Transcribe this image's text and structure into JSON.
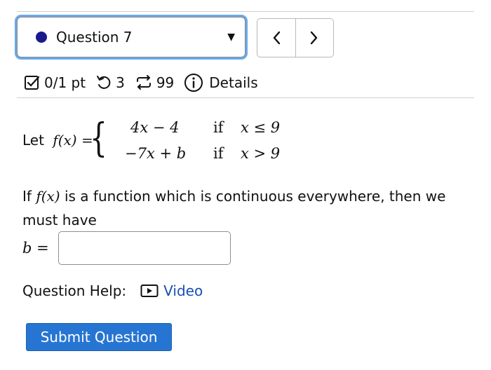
{
  "question_selector": {
    "label": "Question 7",
    "status_color": "#1a1a8c"
  },
  "nav": {
    "prev": "<",
    "next": ">"
  },
  "info": {
    "score": "0/1 pt",
    "retries": "3",
    "attempts": "99",
    "details": "Details"
  },
  "problem": {
    "intro": "Let",
    "func": "f(x) =",
    "pieces": [
      {
        "expr": "4x − 4",
        "cond_word": "if",
        "cond": "x ≤ 9"
      },
      {
        "expr": "−7x + b",
        "cond_word": "if",
        "cond": "x > 9"
      }
    ],
    "line_if": "If",
    "line_fx": "f(x)",
    "line_rest": " is a function which is continuous everywhere, then we",
    "line2": "must have",
    "answer_label": "b =",
    "answer_value": ""
  },
  "help": {
    "label": "Question Help:",
    "video": "Video"
  },
  "submit_label": "Submit Question",
  "colors": {
    "accent": "#2775d3",
    "link": "#1a4fb0",
    "focus": "#69a9ea"
  }
}
